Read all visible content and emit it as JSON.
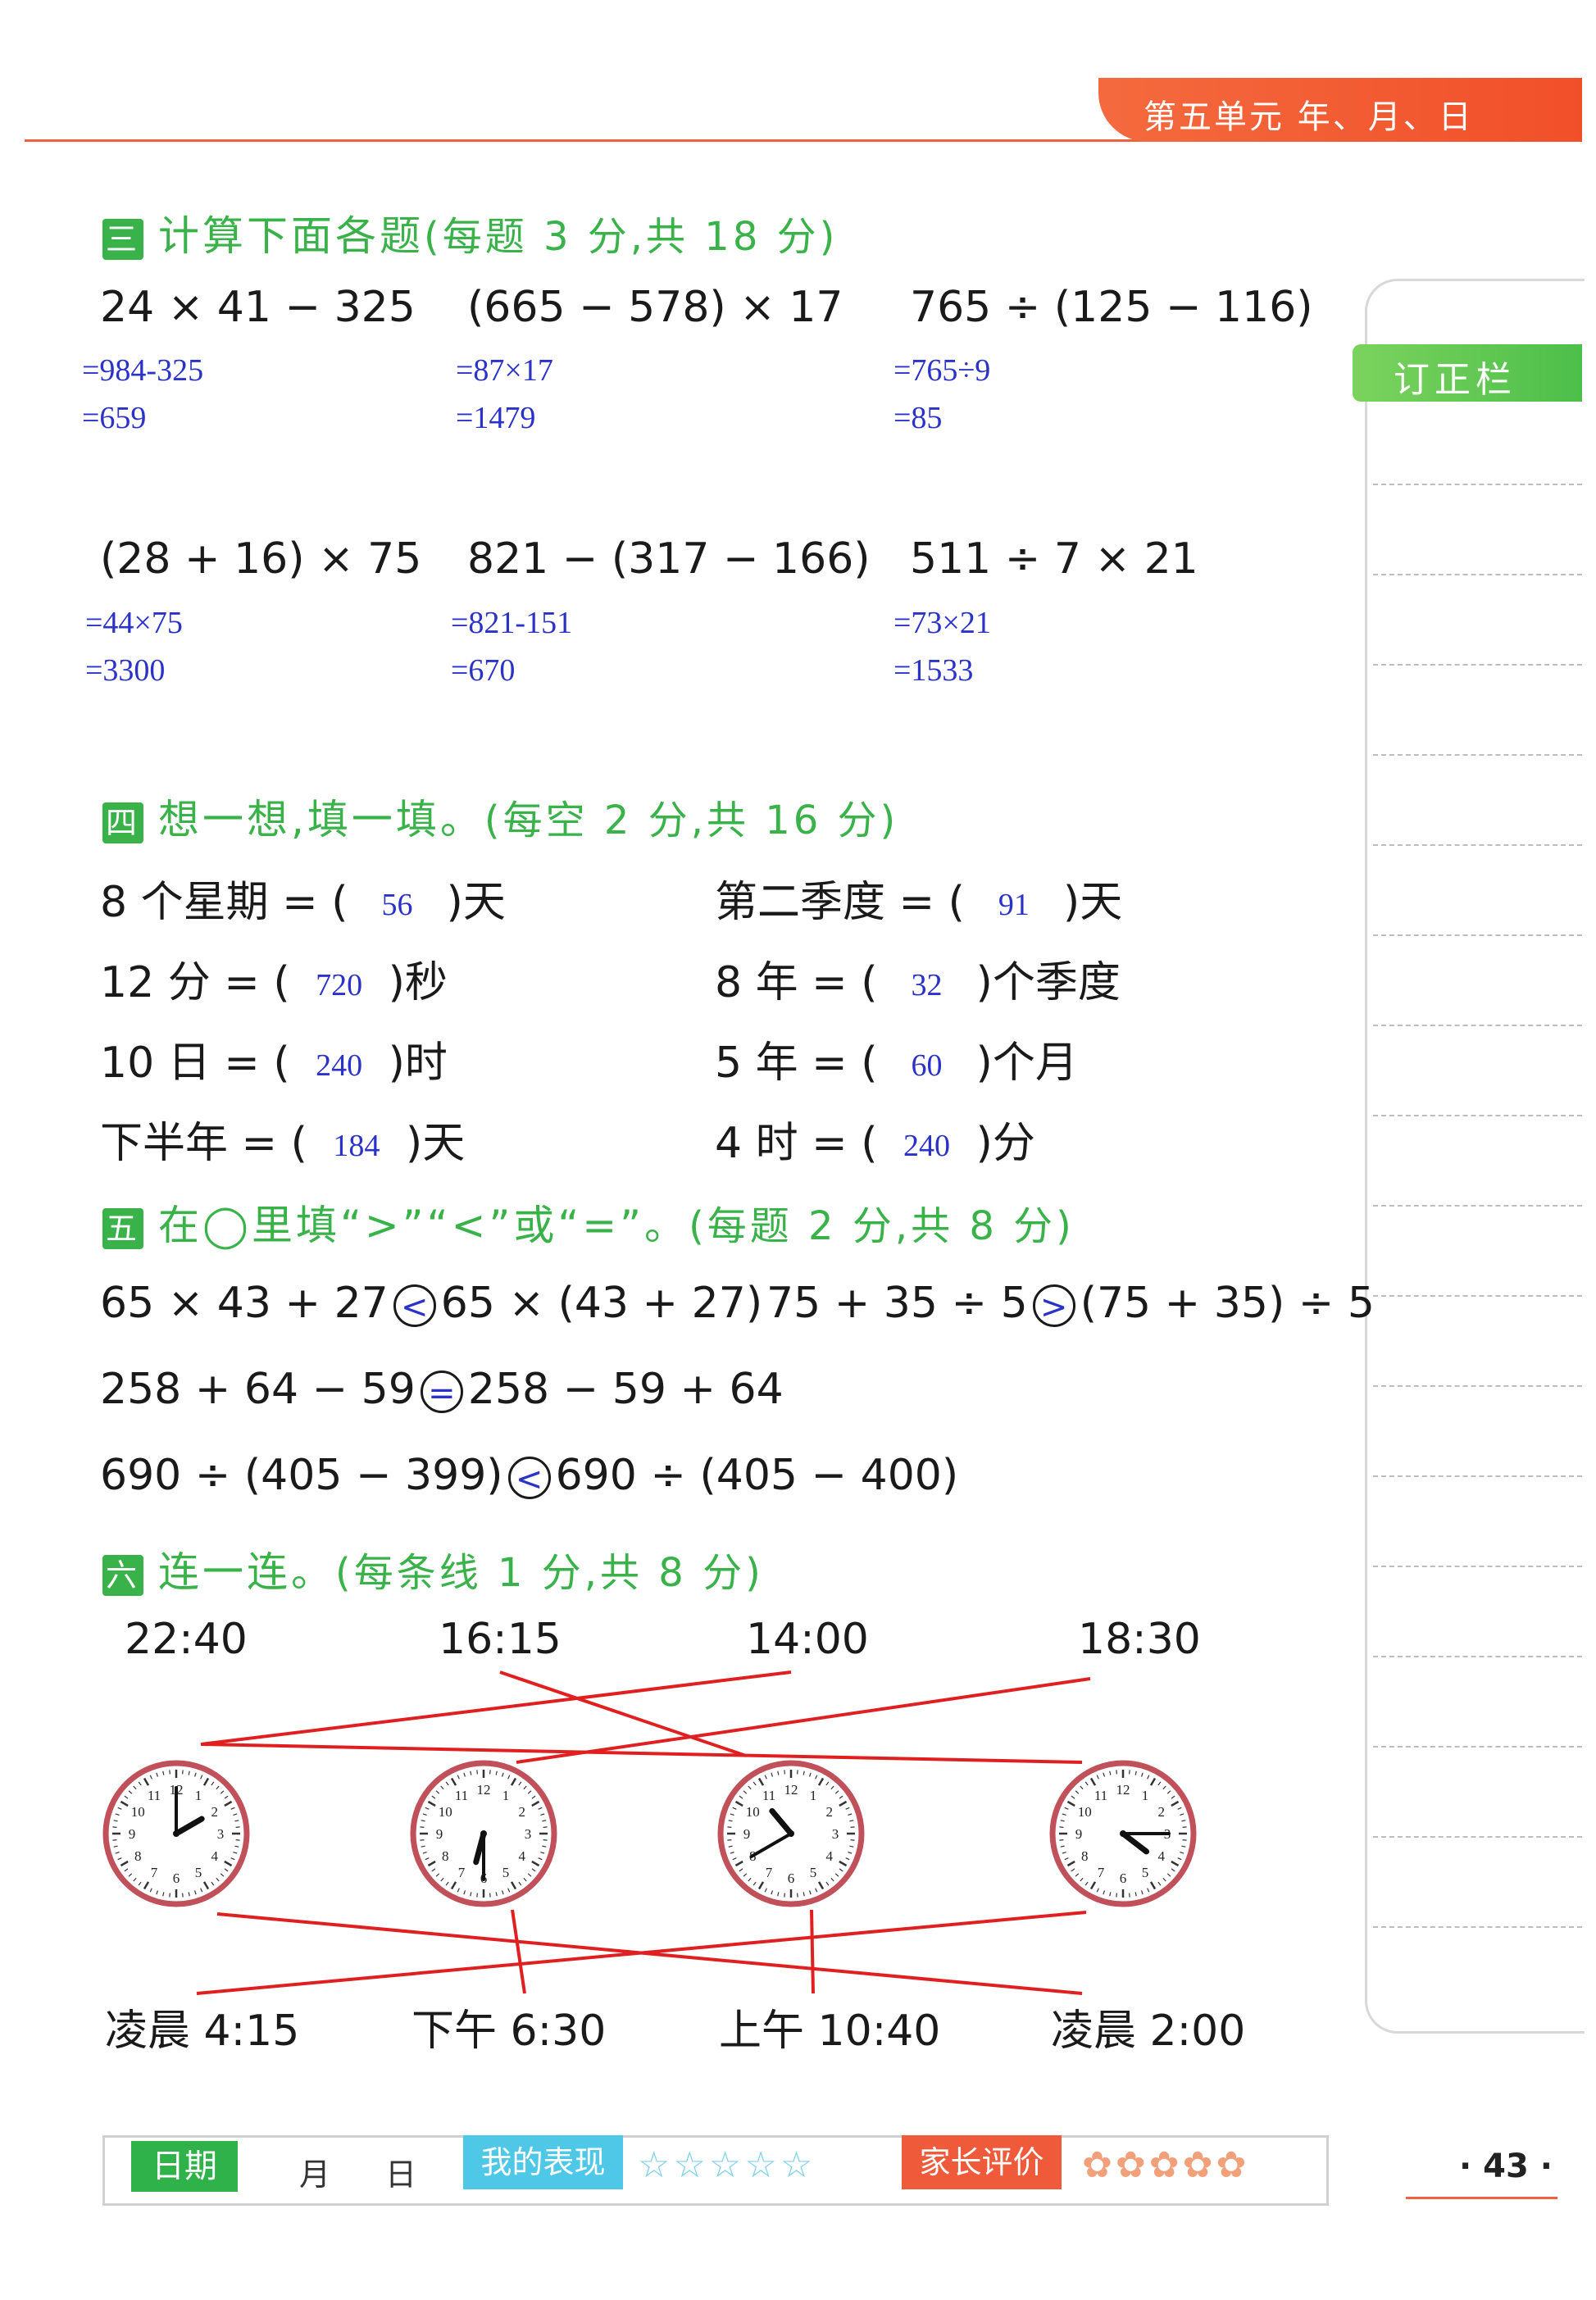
{
  "header": {
    "unit": "第五单元  年、月、日"
  },
  "sidebar": {
    "label": "订正栏"
  },
  "section3": {
    "badge": "三",
    "title": "计算下面各题",
    "note": "(每题 3 分,共 18 分)",
    "problems": [
      {
        "expr": "24 × 41 − 325",
        "steps": [
          "=984-325",
          "=659"
        ]
      },
      {
        "expr": "(665 − 578) × 17",
        "steps": [
          "=87×17",
          "=1479"
        ]
      },
      {
        "expr": "765 ÷ (125 − 116)",
        "steps": [
          "=765÷9",
          "=85"
        ]
      },
      {
        "expr": "(28 + 16) × 75",
        "steps": [
          "=44×75",
          "=3300"
        ]
      },
      {
        "expr": "821 − (317 − 166)",
        "steps": [
          "=821-151",
          "=670"
        ]
      },
      {
        "expr": "511 ÷ 7 × 21",
        "steps": [
          "=73×21",
          "=1533"
        ]
      }
    ]
  },
  "section4": {
    "badge": "四",
    "title": "想一想,填一填。",
    "note": "(每空 2 分,共 16 分)",
    "items": [
      {
        "pre": "8 个星期 = (",
        "ans": "56",
        "post": ")天"
      },
      {
        "pre": "第二季度 = (",
        "ans": "91",
        "post": ")天"
      },
      {
        "pre": "12 分 = (",
        "ans": "720",
        "post": ")秒"
      },
      {
        "pre": "8 年 = (",
        "ans": "32",
        "post": ")个季度"
      },
      {
        "pre": "10 日 = (",
        "ans": "240",
        "post": ")时"
      },
      {
        "pre": "5 年 = (",
        "ans": "60",
        "post": ")个月"
      },
      {
        "pre": "下半年 = (",
        "ans": "184",
        "post": ")天"
      },
      {
        "pre": "4 时 = (",
        "ans": "240",
        "post": ")分"
      }
    ]
  },
  "section5": {
    "badge": "五",
    "title": "在◯里填“>”“<”或“=”。",
    "note": "(每题 2 分,共 8 分)",
    "items": [
      {
        "left": "65 × 43 + 27",
        "sign": "<",
        "right": "65 × (43 + 27)"
      },
      {
        "left": "75 + 35 ÷ 5",
        "sign": ">",
        "right": "(75 + 35) ÷ 5"
      },
      {
        "left": "258 + 64 − 59",
        "sign": "=",
        "right": "258 − 59 + 64"
      },
      {
        "left": "690 ÷ (405 − 399)",
        "sign": "<",
        "right": "690 ÷ (405 − 400)"
      }
    ]
  },
  "section6": {
    "badge": "六",
    "title": "连一连。",
    "note": "(每条线 1 分,共 8 分)",
    "top_times": [
      "22:40",
      "16:15",
      "14:00",
      "18:30"
    ],
    "bottom_times": [
      "凌晨 4:15",
      "下午 6:30",
      "上午 10:40",
      "凌晨 2:00"
    ],
    "clocks": [
      {
        "hour": 2,
        "minute": 0
      },
      {
        "hour": 6,
        "minute": 30
      },
      {
        "hour": 10,
        "minute": 40
      },
      {
        "hour": 4,
        "minute": 15
      }
    ]
  },
  "footer": {
    "date_label": "日期",
    "month": "月",
    "day": "日",
    "performance_label": "我的表现",
    "performance_stars": "☆☆☆☆☆",
    "parent_label": "家长评价",
    "parent_flowers": "✿✿✿✿✿",
    "page": "· 43 ·"
  },
  "colors": {
    "accent": "#3ab24a",
    "header": "#f0623c",
    "handwriting": "#2b32c8",
    "lines": "#e02020",
    "clock_rim": "#c0505a"
  }
}
